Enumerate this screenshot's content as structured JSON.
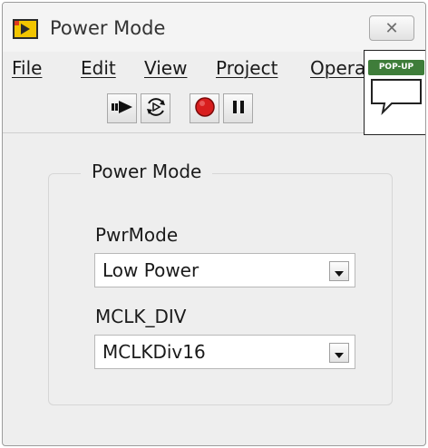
{
  "window": {
    "title": "Power Mode",
    "close_glyph": "✕"
  },
  "menu": {
    "items": [
      "File",
      "Edit",
      "View",
      "Project",
      "Opera"
    ]
  },
  "toolbar": {
    "buttons": [
      "run-arrow-icon",
      "run-continuously-icon",
      "abort-icon",
      "pause-icon"
    ]
  },
  "popup": {
    "label": "POP-UP"
  },
  "panel": {
    "title": "Power Mode",
    "fields": [
      {
        "label": "PwrMode",
        "value": "Low Power"
      },
      {
        "label": "MCLK_DIV",
        "value": "MCLKDiv16"
      }
    ]
  },
  "colors": {
    "abort_red": "#d81e1e",
    "popup_green": "#3f7d3a",
    "window_bg": "#eeeeee"
  }
}
